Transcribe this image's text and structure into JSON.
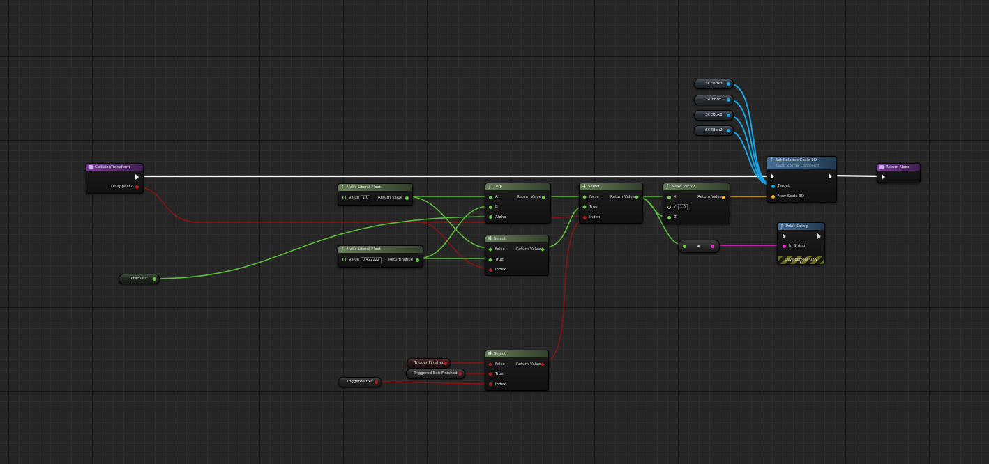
{
  "nodes": {
    "collision_transform": {
      "title": "CollisionTransform",
      "pin_disappear": "Disappear?"
    },
    "make_literal_1": {
      "title": "Make Literal Float",
      "value_label": "Value",
      "value": "1.0",
      "output": "Return Value"
    },
    "make_literal_2": {
      "title": "Make Literal Float",
      "value_label": "Value",
      "value": "0.422222",
      "output": "Return Value"
    },
    "lerp": {
      "title": "Lerp",
      "pin_a": "A",
      "pin_b": "B",
      "pin_alpha": "Alpha",
      "output": "Return Value"
    },
    "select_1": {
      "title": "Select",
      "pin_false": "False",
      "pin_true": "True",
      "pin_index": "Index",
      "output": "Return Value"
    },
    "select_2": {
      "title": "Select",
      "pin_false": "False",
      "pin_true": "True",
      "pin_index": "Index",
      "output": "Return Value"
    },
    "select_3": {
      "title": "Select",
      "pin_false": "False",
      "pin_true": "True",
      "pin_index": "Index",
      "output": "Return Value"
    },
    "make_vector": {
      "title": "Make Vector",
      "pin_x": "X",
      "pin_y": "Y",
      "y_value": "1.0",
      "pin_z": "Z",
      "output": "Return Value"
    },
    "set_relative_scale": {
      "title": "Set Relative Scale 3D",
      "subtitle": "Target is Scene Component",
      "pin_target": "Target",
      "pin_new_scale": "New Scale 3D"
    },
    "return_node": {
      "title": "Return Node"
    },
    "print_string": {
      "title": "Print String",
      "pin_in_string": "In String",
      "footer": "Development Only"
    }
  },
  "variables": {
    "scebox3": "SCEBox3",
    "scebox": "SCEBox",
    "scebox1": "SCEBox1",
    "scebox2": "SCEBox2",
    "frac_out": "Frac Out",
    "trigger_finished": "Trigger Finished",
    "triggered_exit_finished": "Triggered Exit Finished",
    "triggered_exit": "Triggered Exit"
  },
  "colors": {
    "exec": "#ffffff",
    "float": "#6fce4c",
    "bool": "#a01e1e",
    "object": "#1ba6e8",
    "vector": "#f5b927",
    "string": "#f02fcf",
    "header_function": "#667d59",
    "header_purple": "#7b3a9c",
    "header_blue": "#476f94"
  }
}
